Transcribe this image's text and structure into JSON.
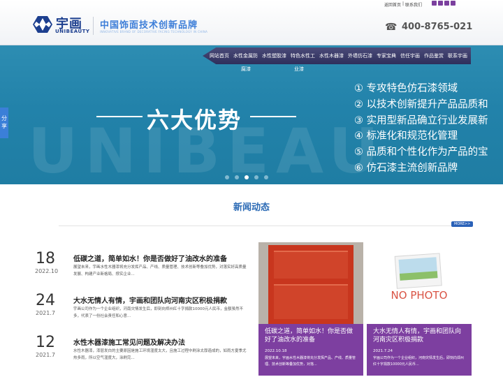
{
  "header": {
    "top_links": [
      "返回首页",
      "|",
      "联系我们"
    ],
    "logo_cn": "宇画",
    "logo_en": "UNIBEAUTY",
    "brand_cn": "中国饰面技术创新品牌",
    "brand_en": "INNOVATIVE BRAND OF DECORATIVE FACING TECHNOLOGY IN CHINA",
    "phone": "400-8765-021",
    "colors": {
      "brand": "#1d3f8f",
      "accent": "#3d7ed8",
      "purple": "#7d3fa0"
    }
  },
  "nav": {
    "items": [
      "网站首页",
      "水性金属防",
      "水性塑胶漆",
      "特色水性工",
      "水性木器漆",
      "外墙仿石漆",
      "专家宝典",
      "信任宇画",
      "作品鉴赏",
      "联系宇画"
    ],
    "sub_items": [
      "腐漆",
      "业漆"
    ]
  },
  "banner": {
    "watermark": "UNIBEAU",
    "title": "六大优势",
    "advantages": [
      "① 专攻特色仿石漆领域",
      "② 以技术创新提升产品品质和",
      "③ 实用型新品确立行业发展新",
      "④ 标准化和规范化管理",
      "⑤ 品质和个性化作为产品的宝",
      "⑥ 仿石漆主流创新品牌"
    ]
  },
  "share": {
    "label": "分享"
  },
  "news": {
    "title": "新闻动态",
    "more": "MORE>>",
    "items": [
      {
        "day": "18",
        "date": "2022.10",
        "title": "低碳之道，简单如水！你是否做好了油改水的准备",
        "desc": "展望未来，宇画水性木器漆将充分发挥产品、产线、质量管理、技术创新等叠加优势，对落实好高质量发展、构建产业新格局、撑实企业..."
      },
      {
        "day": "24",
        "date": "2021.7",
        "title": "大水无情人有情，宇画和团队向河南灾区积极捐款",
        "desc": "宇画公司作为一个企业组织，河南灾情发生后，即刻向郑州红十字捐款10000元人民币，金额虽然不多，代表了一份社会责任和心意..."
      },
      {
        "day": "12",
        "date": "2021.7",
        "title": "水性木器漆施工常见问题及解决办法",
        "desc": "水性木器漆，漆层发白的主要原因是施工环境湿度太大，且施工过程中刷涂太厚造成的，如雨方夏季尤热多雨，所以空气湿度大，涂刷完..."
      }
    ],
    "cards": [
      {
        "title": "低碳之道，简单如水！你是否做好了油改水的准备",
        "date": "2022.10.18",
        "desc": "展望未来，宇画水性木器漆将充分发挥产品、产线、质量管理、技术创新等叠加优势，对落..."
      },
      {
        "title": "大水无情人有情，宇画和团队向河南灾区积极捐款",
        "date": "2021.7.24",
        "desc": "宇画公司作为一个企业组织，河南灾情发生后，即刻向郑州红十字捐款10000元人民币...",
        "image_text": "NO PHOTO"
      }
    ]
  }
}
